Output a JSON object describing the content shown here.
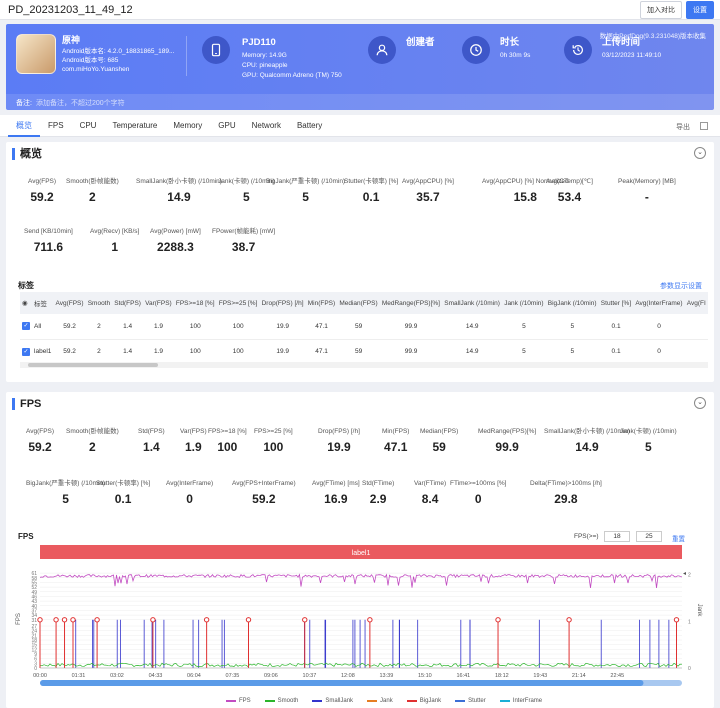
{
  "window": {
    "title": "PD_20231203_11_49_12",
    "btn_compare": "加入对比",
    "btn_settings": "设置"
  },
  "hero": {
    "app_name": "原神",
    "android_ver": "Android版本名: 4.2.0_18831865_189...",
    "android_code": "Android版本号: 685",
    "package": "com.miHoYo.Yuanshen",
    "device": "PJD110",
    "memory": "Memory: 14.9G",
    "cpu": "CPU: pineapple",
    "gpu": "GPU: Qualcomm Adreno (TM) 750",
    "creator_label": "创建者",
    "duration_label": "时长",
    "duration": "0h 30m 9s",
    "upload_label": "上传时间",
    "upload_time": "03/12/2023 11:49:10",
    "perfdog": "数据由PerfDog(9.3.231048)版本收集",
    "remark_label": "备注:",
    "remark_placeholder": "添加备注，不超过200个字符"
  },
  "tabs": [
    "概览",
    "FPS",
    "CPU",
    "Temperature",
    "Memory",
    "GPU",
    "Network",
    "Battery"
  ],
  "export": "导出",
  "overview": {
    "title": "概览",
    "row1": [
      {
        "label": "Avg(FPS)",
        "value": "59.2"
      },
      {
        "label": "Smooth(卧帧能数)",
        "value": "2"
      },
      {
        "label": "SmallJank(卧小卡顿) (/10min)",
        "value": "14.9"
      },
      {
        "label": "Jank(卡顿) (/10min)",
        "value": "5"
      },
      {
        "label": "BigJank(严重卡顿) (/10min)",
        "value": "5"
      },
      {
        "label": "Stutter(卡顿率) [%]",
        "value": "0.1"
      },
      {
        "label": "Avg(AppCPU) [%]",
        "value": "35.7"
      },
      {
        "label": "Avg(AppCPU) [%] Normalized",
        "value": "15.8"
      },
      {
        "label": "Avg(CTemp)[℃]",
        "value": "53.4"
      },
      {
        "label": "Peak(Memory) [MB]",
        "value": "-"
      }
    ],
    "row2": [
      {
        "label": "Send [KB/10min]",
        "value": "711.6"
      },
      {
        "label": "Avg(Recv) [KB/s]",
        "value": "1"
      },
      {
        "label": "Avg(Power) [mW]",
        "value": "2288.3"
      },
      {
        "label": "FPower(帧能耗) [mW]",
        "value": "38.7"
      }
    ],
    "label_section": "标签",
    "label_settings": "参数显示设置",
    "table_headers": [
      "标签",
      "Avg(FPS)",
      "Smooth",
      "Std(FPS)",
      "Var(FPS)",
      "FPS>=18 [%]",
      "FPS>=25 [%]",
      "Drop(FPS) [/h]",
      "Min(FPS)",
      "Median(FPS)",
      "MedRange(FPS)[%]",
      "SmallJank (/10min)",
      "Jank (/10min)",
      "BigJank (/10min)",
      "Stutter [%]",
      "Avg(InterFrame)",
      "Avg(FI"
    ],
    "table_rows": [
      [
        "All",
        "59.2",
        "2",
        "1.4",
        "1.9",
        "100",
        "100",
        "19.9",
        "47.1",
        "59",
        "99.9",
        "14.9",
        "5",
        "5",
        "0.1",
        "0",
        ""
      ],
      [
        "label1",
        "59.2",
        "2",
        "1.4",
        "1.9",
        "100",
        "100",
        "19.9",
        "47.1",
        "59",
        "99.9",
        "14.9",
        "5",
        "5",
        "0.1",
        "0",
        ""
      ]
    ]
  },
  "fps": {
    "title": "FPS",
    "row1": [
      {
        "label": "Avg(FPS)",
        "value": "59.2"
      },
      {
        "label": "Smooth(卧帧能数)",
        "value": "2"
      },
      {
        "label": "Std(FPS)",
        "value": "1.4"
      },
      {
        "label": "Var(FPS)",
        "value": "1.9"
      },
      {
        "label": "FPS>=18 [%]",
        "value": "100"
      },
      {
        "label": "FPS>=25 [%]",
        "value": "100"
      },
      {
        "label": "Drop(FPS) [/h]",
        "value": "19.9"
      },
      {
        "label": "Min(FPS)",
        "value": "47.1"
      },
      {
        "label": "Median(FPS)",
        "value": "59"
      },
      {
        "label": "MedRange(FPS)[%]",
        "value": "99.9"
      },
      {
        "label": "SmallJank(卧小卡顿) (/10min)",
        "value": "14.9"
      },
      {
        "label": "Jank(卡顿) (/10min)",
        "value": "5"
      }
    ],
    "row2": [
      {
        "label": "BigJank(严重卡顿) (/10min)",
        "value": "5"
      },
      {
        "label": "Stutter(卡顿率) [%]",
        "value": "0.1"
      },
      {
        "label": "Avg(InterFrame)",
        "value": "0"
      },
      {
        "label": "Avg(FPS+InterFrame)",
        "value": "59.2"
      },
      {
        "label": "Avg(FTime) [ms]",
        "value": "16.9"
      },
      {
        "label": "Std(FTime)",
        "value": "2.9"
      },
      {
        "label": "Var(FTime)",
        "value": "8.4"
      },
      {
        "label": "FTime>=100ms [%]",
        "value": "0"
      },
      {
        "label": "Delta(FTime)>100ms [/h]",
        "value": "29.8"
      }
    ],
    "chart_title": "FPS",
    "threshold_label": "FPS(>=)",
    "threshold1": "18",
    "threshold2": "25",
    "reset": "重置",
    "band_label": "label1"
  },
  "chart_data": {
    "type": "line",
    "ylabel": "FPS",
    "y2label": "Jank",
    "ylim": [
      0,
      63
    ],
    "yticks": [
      0,
      3,
      6,
      9,
      12,
      15,
      18,
      21,
      24,
      27,
      31,
      34,
      37,
      40,
      43,
      46,
      49,
      52,
      55,
      58,
      61
    ],
    "y2ticks": [
      0,
      1,
      2
    ],
    "x": [
      "00:00",
      "01:31",
      "03:02",
      "04:33",
      "06:04",
      "07:35",
      "09:06",
      "10:37",
      "12:08",
      "13:39",
      "15:10",
      "16:41",
      "18:12",
      "19:43",
      "21:14",
      "22:45"
    ],
    "fps_level": 59.2,
    "smooth_level": 2,
    "bigjank_markers": [
      "00:00",
      "00:38",
      "00:58",
      "01:18",
      "02:15",
      "04:27",
      "06:34",
      "08:13",
      "10:26",
      "13:00",
      "18:03",
      "20:51",
      "25:05"
    ],
    "series": [
      {
        "name": "FPS",
        "color": "#c24cc2"
      },
      {
        "name": "Smooth",
        "color": "#2bb52b"
      },
      {
        "name": "SmallJank",
        "color": "#3333cc"
      },
      {
        "name": "Jank",
        "color": "#e67e22"
      },
      {
        "name": "BigJank",
        "color": "#e03030"
      },
      {
        "name": "Stutter",
        "color": "#3b6fd6"
      },
      {
        "name": "InterFrame",
        "color": "#1ab0d6"
      }
    ]
  }
}
